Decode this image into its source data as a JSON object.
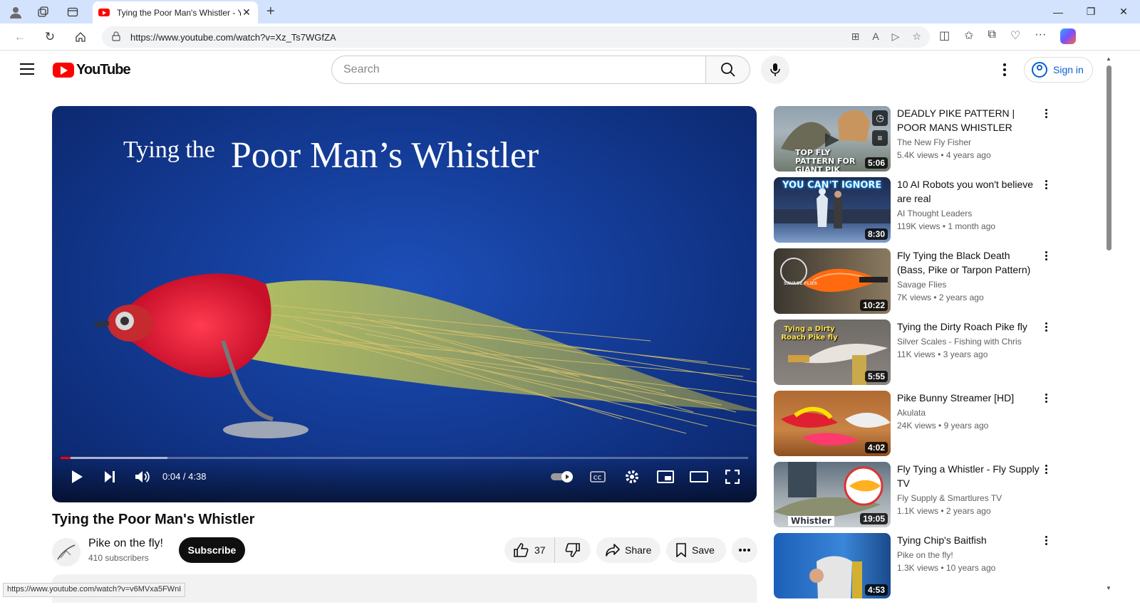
{
  "browser": {
    "tab_title": "Tying the Poor Man's Whistler - Yo",
    "url": "https://www.youtube.com/watch?v=Xz_Ts7WGfZA",
    "status_url": "https://www.youtube.com/watch?v=v6MVxa5FWnI"
  },
  "header": {
    "logo_text": "YouTube",
    "search_placeholder": "Search",
    "sign_in": "Sign in"
  },
  "player": {
    "overlay_title_small": "Tying the",
    "overlay_title_big": "Poor Man’s Whistler",
    "time": "0:04 / 4:38",
    "played_fraction": 0.0145,
    "loaded_fraction": 0.155
  },
  "video": {
    "title": "Tying the Poor Man's Whistler",
    "channel": "Pike on the fly!",
    "subscribers": "410 subscribers",
    "subscribe_label": "Subscribe",
    "likes": "37",
    "share_label": "Share",
    "save_label": "Save"
  },
  "recommendations": [
    {
      "title": "DEADLY PIKE PATTERN | POOR MANS WHISTLER",
      "channel": "The New Fly Fisher",
      "views": "5.4K views",
      "age": "4 years ago",
      "duration": "5:06",
      "thumb_text": "TOP FLY PATTERN FOR GIANT PIK"
    },
    {
      "title": "10 AI Robots you won't believe are real",
      "channel": "AI Thought Leaders",
      "views": "119K views",
      "age": "1 month ago",
      "duration": "8:30",
      "thumb_text": "YOU CAN'T IGNORE"
    },
    {
      "title": "Fly Tying the Black Death (Bass, Pike or Tarpon Pattern)",
      "channel": "Savage Flies",
      "views": "7K views",
      "age": "2 years ago",
      "duration": "10:22",
      "thumb_text": "SAVAGE FLIES"
    },
    {
      "title": "Tying the Dirty Roach Pike fly",
      "channel": "Silver Scales - Fishing with Chris",
      "views": "11K views",
      "age": "3 years ago",
      "duration": "5:55",
      "thumb_text": "Tying a Dirty Roach Pike fly"
    },
    {
      "title": "Pike Bunny Streamer [HD]",
      "channel": "Akulata",
      "views": "24K views",
      "age": "9 years ago",
      "duration": "4:02",
      "thumb_text": ""
    },
    {
      "title": "Fly Tying a Whistler - Fly Supply TV",
      "channel": "Fly Supply & Smartlures TV",
      "views": "1.1K views",
      "age": "2 years ago",
      "duration": "19:05",
      "thumb_text": "Whistler"
    },
    {
      "title": "Tying Chip's Baitfish",
      "channel": "Pike on the fly!",
      "views": "1.3K views",
      "age": "10 years ago",
      "duration": "4:53",
      "thumb_text": ""
    }
  ],
  "colors": {
    "brand_red": "#ff0000",
    "link_blue": "#065fd4",
    "player_blue": "#143c97"
  }
}
